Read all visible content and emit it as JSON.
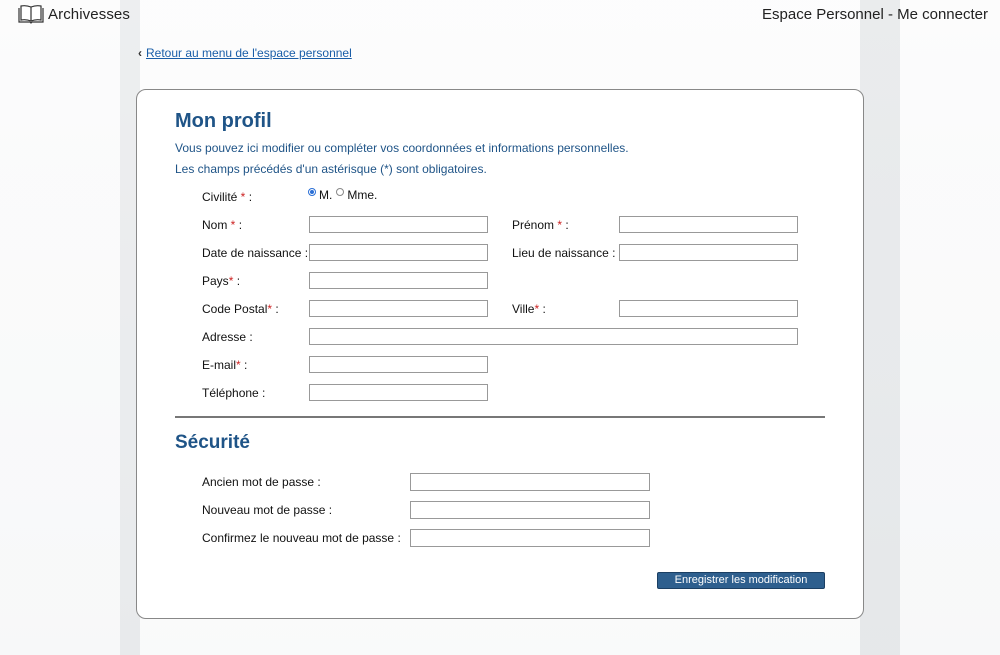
{
  "header": {
    "logo_text": "Archivesses",
    "right_text": "Espace Personnel - Me connecter"
  },
  "back_link": {
    "chevron": "‹",
    "label": "Retour au menu de l'espace personnel"
  },
  "profile": {
    "title": "Mon profil",
    "intro_line1": "Vous pouvez ici modifier ou compléter vos coordonnées et informations personnelles.",
    "intro_line2": "Les champs précédés d'un astérisque (*) sont obligatoires.",
    "civility": {
      "label": "Civilité",
      "required_mark": " * ",
      "colon": ":",
      "options": [
        {
          "label": "M.",
          "selected": true
        },
        {
          "label": "Mme.",
          "selected": false
        }
      ]
    },
    "fields": {
      "nom": {
        "label": "Nom",
        "required_mark": " * ",
        "colon": ":",
        "value": ""
      },
      "prenom": {
        "label": "Prénom",
        "required_mark": " * ",
        "colon": ":",
        "value": ""
      },
      "date_naissance": {
        "label": "Date de naissance :",
        "value": ""
      },
      "lieu_naissance": {
        "label": "Lieu de naissance :",
        "value": ""
      },
      "pays": {
        "label": "Pays",
        "required_mark": "*",
        "colon": " :",
        "value": ""
      },
      "code_postal": {
        "label": "Code Postal",
        "required_mark": "*",
        "colon": " :",
        "value": ""
      },
      "ville": {
        "label": "Ville",
        "required_mark": "*",
        "colon": " :",
        "value": ""
      },
      "adresse": {
        "label": "Adresse :",
        "value": ""
      },
      "email": {
        "label": "E-mail",
        "required_mark": "*",
        "colon": " :",
        "value": ""
      },
      "telephone": {
        "label": "Téléphone :",
        "value": ""
      }
    }
  },
  "security": {
    "title": "Sécurité",
    "old_password_label": "Ancien mot de passe :",
    "new_password_label": "Nouveau mot de passe :",
    "confirm_password_label": "Confirmez le nouveau mot de passe :"
  },
  "submit_label": "Enregistrer les modification",
  "icons": {
    "logo": "open-book-icon",
    "back": "chevron-left-icon"
  },
  "colors": {
    "heading": "#1f5487",
    "link": "#1a5ea8",
    "required": "#cc2222",
    "button": "#2e5f8e"
  }
}
